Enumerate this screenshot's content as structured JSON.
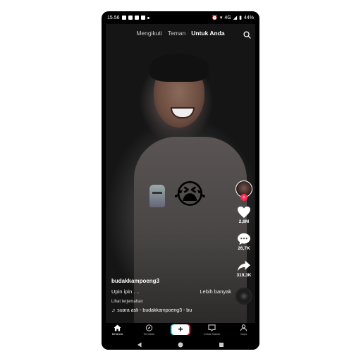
{
  "statusbar": {
    "time": "15.56",
    "network": "4G",
    "battery": "44%"
  },
  "topnav": {
    "tabs": [
      {
        "label": "Mengikuti",
        "active": false,
        "dot": true
      },
      {
        "label": "Teman",
        "active": false,
        "dot": true
      },
      {
        "label": "Untuk Anda",
        "active": true,
        "dot": false
      }
    ]
  },
  "icons": {
    "search": "search-icon",
    "heart": "heart-icon",
    "comment": "comment-icon",
    "share": "share-icon",
    "music": "music-note-icon",
    "home": "home-icon",
    "discover": "compass-icon",
    "inbox": "inbox-icon",
    "profile": "profile-icon"
  },
  "actions": {
    "likes": "2,8M",
    "comments": "26,7K",
    "shares": "319,3K"
  },
  "caption": {
    "username": "budakkampoeng3",
    "text": "Upin ipin . ..",
    "more": "Lebih banyak",
    "translate": "Lihat terjemahan",
    "music": "suara asli - budakkampoeng3 - bu"
  },
  "bottomnav": {
    "items": [
      {
        "label": "Beranda",
        "active": true
      },
      {
        "label": "Temukan",
        "active": false
      },
      {
        "label": "+",
        "active": false
      },
      {
        "label": "Kotak Masuk",
        "active": false
      },
      {
        "label": "Saya",
        "active": false
      }
    ]
  },
  "colors": {
    "accent": "#fe2c55",
    "cyan": "#25f4ee",
    "background": "#000000"
  }
}
